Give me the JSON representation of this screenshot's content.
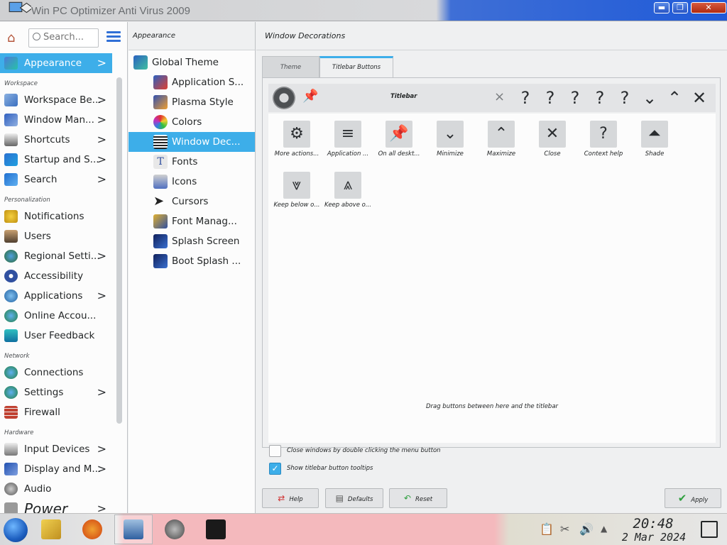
{
  "window": {
    "title": "Win PC Optimizer Anti Virus 2009",
    "close_label": "✕",
    "max_label": "❐",
    "min_label": "▬"
  },
  "sidebar": {
    "search_placeholder": "Search...",
    "sections": {
      "workspace": "Workspace",
      "personalization": "Personalization",
      "network": "Network",
      "hardware": "Hardware"
    },
    "items": [
      {
        "label": "Appearance",
        "chevron": ">"
      },
      {
        "label": "Workspace Be...",
        "chevron": ">"
      },
      {
        "label": "Window Man...",
        "chevron": ">"
      },
      {
        "label": "Shortcuts",
        "chevron": ">"
      },
      {
        "label": "Startup and S...",
        "chevron": ">"
      },
      {
        "label": "Search",
        "chevron": ">"
      },
      {
        "label": "Notifications"
      },
      {
        "label": "Users"
      },
      {
        "label": "Regional Setti...",
        "chevron": ">"
      },
      {
        "label": "Accessibility"
      },
      {
        "label": "Applications",
        "chevron": ">"
      },
      {
        "label": "Online Accou..."
      },
      {
        "label": "User Feedback"
      },
      {
        "label": "Connections"
      },
      {
        "label": "Settings",
        "chevron": ">"
      },
      {
        "label": "Firewall"
      },
      {
        "label": "Input Devices",
        "chevron": ">"
      },
      {
        "label": "Display and M...",
        "chevron": ">"
      },
      {
        "label": "Audio"
      },
      {
        "label": "Power",
        "chevron": ">"
      }
    ]
  },
  "categories": {
    "header": "Appearance",
    "items": [
      {
        "label": "Global Theme"
      },
      {
        "label": "Application S..."
      },
      {
        "label": "Plasma Style"
      },
      {
        "label": "Colors"
      },
      {
        "label": "Window Dec..."
      },
      {
        "label": "Fonts"
      },
      {
        "label": "Icons"
      },
      {
        "label": "Cursors"
      },
      {
        "label": "Font Manag..."
      },
      {
        "label": "Splash Screen"
      },
      {
        "label": "Boot Splash ..."
      }
    ]
  },
  "main": {
    "header": "Window Decorations",
    "tabs": [
      "Theme",
      "Titlebar Buttons"
    ],
    "titlebar_label": "Titlebar",
    "titlebar_glyphs": {
      "pin": "📌",
      "close_small": "×",
      "help": "?",
      "minimize": "⌄",
      "maximize": "⌃",
      "close": "✕"
    },
    "pool": [
      {
        "glyph": "⚙",
        "label": "More actions..."
      },
      {
        "glyph": "≡",
        "label": "Application ..."
      },
      {
        "glyph": "📌",
        "label": "On all deskt..."
      },
      {
        "glyph": "⌄",
        "label": "Minimize"
      },
      {
        "glyph": "⌃",
        "label": "Maximize"
      },
      {
        "glyph": "✕",
        "label": "Close"
      },
      {
        "glyph": "?",
        "label": "Context help"
      },
      {
        "glyph": "⏶",
        "label": "Shade"
      },
      {
        "glyph": "⩔",
        "label": "Keep below o..."
      },
      {
        "glyph": "⩓",
        "label": "Keep above o..."
      }
    ],
    "hint": "Drag buttons between here and the titlebar",
    "checkboxes": [
      {
        "label": "Close windows by double clicking the menu button",
        "checked": false
      },
      {
        "label": "Show titlebar button tooltips",
        "checked": true
      }
    ],
    "check_mark": "✓",
    "buttons": {
      "help": "Help",
      "defaults": "Defaults",
      "reset": "Reset",
      "apply": "Apply"
    }
  },
  "taskbar": {
    "time": "20:48",
    "date": "2 Mar 2024"
  }
}
